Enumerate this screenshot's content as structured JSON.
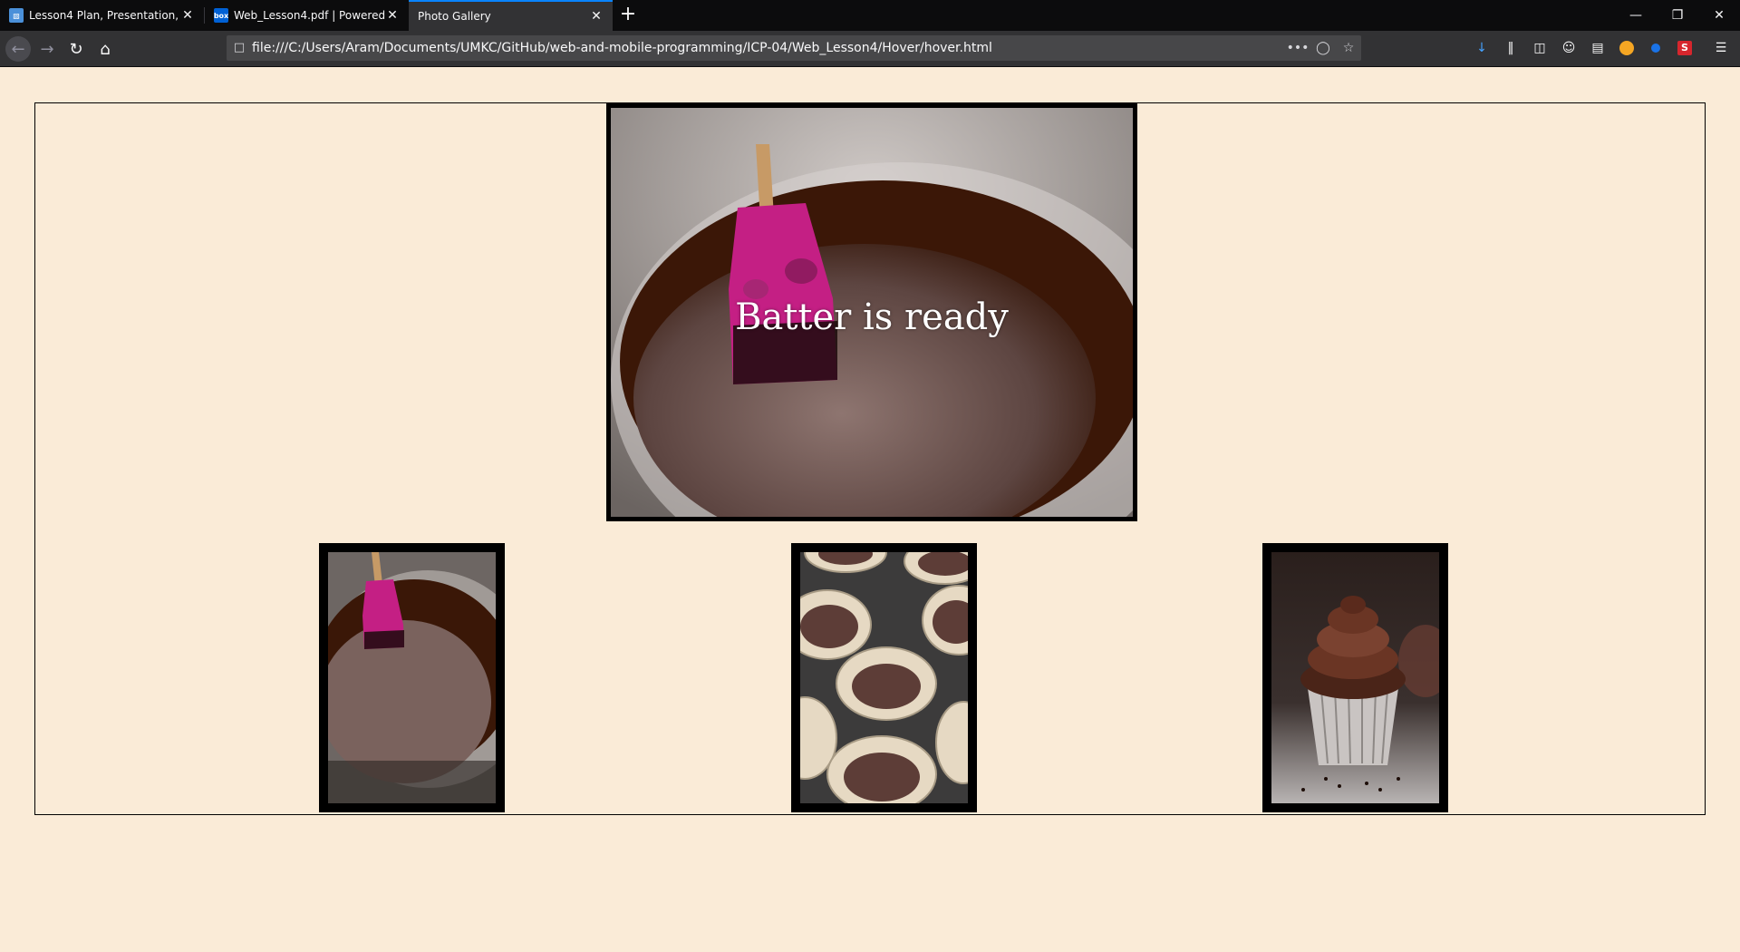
{
  "browser": {
    "tabs": [
      {
        "label": "Lesson4 Plan, Presentation, Sou",
        "favicon": "box-doc-icon",
        "active": false
      },
      {
        "label": "Web_Lesson4.pdf | Powered by",
        "favicon": "box-icon",
        "active": false
      },
      {
        "label": "Photo Gallery",
        "favicon": "",
        "active": true
      }
    ],
    "new_tab": "+",
    "url": "file:///C:/Users/Aram/Documents/UMKC/GitHub/web-and-mobile-programming/ICP-04/Web_Lesson4/Hover/hover.html",
    "accent": "#0a84ff"
  },
  "page": {
    "background": "#faebd7",
    "feature_caption": "Batter is ready",
    "thumbnails": [
      {
        "name": "batter-bowl"
      },
      {
        "name": "cupcake-liners"
      },
      {
        "name": "frosted-cupcake"
      }
    ]
  }
}
